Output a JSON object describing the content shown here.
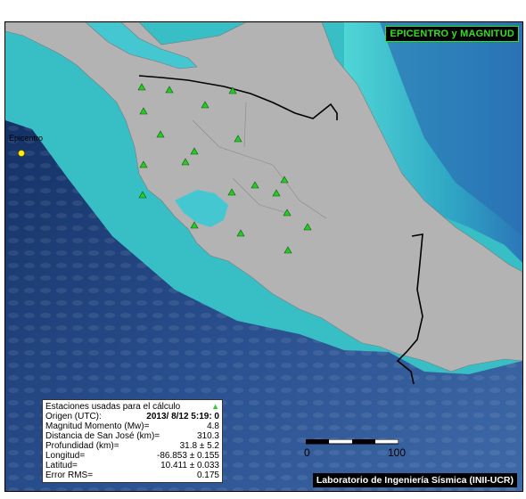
{
  "map": {
    "title": "EPICENTRO y MAGNITUD",
    "credit": "Laboratorio de Ingeniería Sísmica (INII-UCR)",
    "epicenter_label": "Epicentro",
    "colors": {
      "land": "#b3b3b3",
      "shelf": "#3dc8c8",
      "deep_ocean": "#1b3e7a",
      "station": "#22cc22",
      "epicenter": "#ffee00",
      "border": "#000000",
      "badge_text": "#34e01c"
    }
  },
  "info": {
    "stations_label": "Estaciones usadas para el cálculo",
    "rows": [
      {
        "label": "Origen (UTC):",
        "value": "2013/ 8/12 5:19: 0"
      },
      {
        "label": "Magnitud Momento (Mw)=",
        "value": "4.8"
      },
      {
        "label": "Distancia de San José (km)=",
        "value": "310.3"
      },
      {
        "label": "Profundidad (km)=",
        "value": "31.8 ± 5.2"
      },
      {
        "label": "Longitud=",
        "value": "-86.853 ± 0.155"
      },
      {
        "label": "Latitud=",
        "value": "10.411 ± 0.033"
      },
      {
        "label": "Error RMS=",
        "value": "0.175"
      }
    ]
  },
  "scale": {
    "start": "0",
    "end": "100"
  }
}
